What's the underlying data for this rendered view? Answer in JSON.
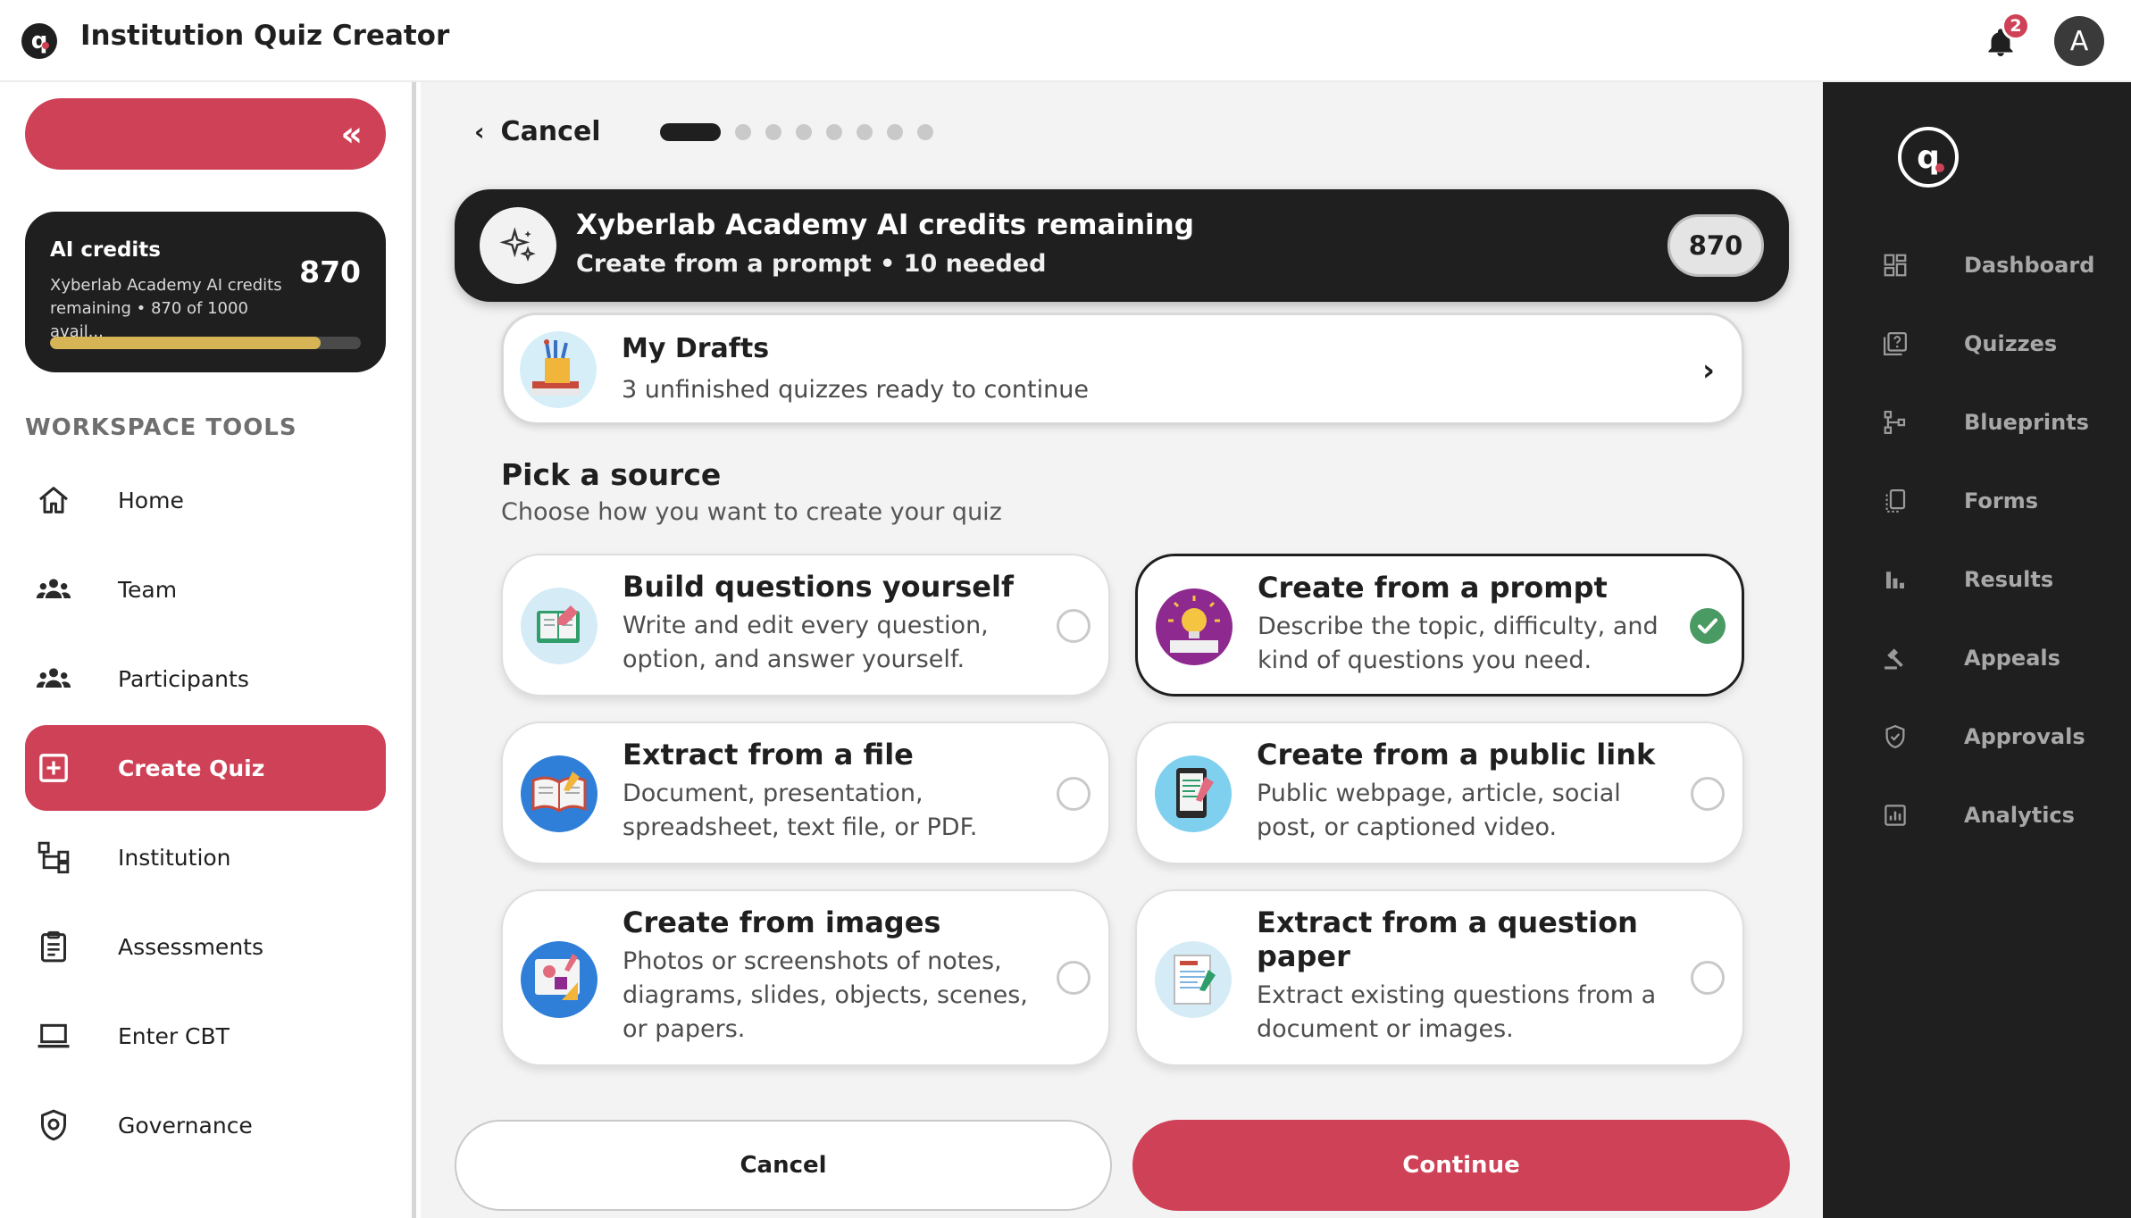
{
  "app": {
    "title": "Institution Quiz Creator",
    "logo_letter": "q",
    "notifications_count": "2",
    "avatar_initial": "A"
  },
  "sidebar": {
    "credits": {
      "title": "AI credits",
      "description": "Xyberlab Academy AI credits remaining • 870 of 1000 avail...",
      "value": "870",
      "progress": 0.87
    },
    "section_title": "WORKSPACE TOOLS",
    "items": [
      {
        "label": "Home",
        "icon": "home-icon"
      },
      {
        "label": "Team",
        "icon": "team-icon"
      },
      {
        "label": "Participants",
        "icon": "participants-icon"
      },
      {
        "label": "Create Quiz",
        "icon": "plus-square-icon",
        "active": true
      },
      {
        "label": "Institution",
        "icon": "org-chart-icon"
      },
      {
        "label": "Assessments",
        "icon": "clipboard-icon"
      },
      {
        "label": "Enter CBT",
        "icon": "laptop-icon"
      },
      {
        "label": "Governance",
        "icon": "shield-icon"
      }
    ]
  },
  "main": {
    "back_label": "Cancel",
    "steps": {
      "total": 8,
      "current": 1
    },
    "banner": {
      "title": "Xyberlab Academy AI credits remaining",
      "subtitle": "Create from a prompt • 10 needed",
      "value": "870"
    },
    "drafts": {
      "title": "My Drafts",
      "subtitle": "3 unfinished quizzes ready to continue"
    },
    "pick": {
      "title": "Pick a source",
      "subtitle": "Choose how you want to create your quiz"
    },
    "options": [
      {
        "title": "Build questions yourself",
        "description": "Write and edit every question, option, and answer yourself.",
        "selected": false
      },
      {
        "title": "Create from a prompt",
        "description": "Describe the topic, difficulty, and kind of questions you need.",
        "selected": true
      },
      {
        "title": "Extract from a file",
        "description": "Document, presentation, spreadsheet, text file, or PDF.",
        "selected": false
      },
      {
        "title": "Create from a public link",
        "description": "Public webpage, article, social post, or captioned video.",
        "selected": false
      },
      {
        "title": "Create from images",
        "description": "Photos or screenshots of notes, diagrams, slides, objects, scenes, or papers.",
        "selected": false
      },
      {
        "title": "Extract from a question paper",
        "description": "Extract existing questions from a document or images.",
        "selected": false
      }
    ],
    "buttons": {
      "cancel": "Cancel",
      "continue": "Continue"
    }
  },
  "rail": {
    "items": [
      {
        "label": "Dashboard",
        "icon": "dashboard-icon"
      },
      {
        "label": "Quizzes",
        "icon": "quiz-icon"
      },
      {
        "label": "Blueprints",
        "icon": "blueprint-icon"
      },
      {
        "label": "Forms",
        "icon": "forms-icon"
      },
      {
        "label": "Results",
        "icon": "results-icon"
      },
      {
        "label": "Appeals",
        "icon": "gavel-icon"
      },
      {
        "label": "Approvals",
        "icon": "shield-check-icon"
      },
      {
        "label": "Analytics",
        "icon": "analytics-icon"
      }
    ]
  },
  "colors": {
    "accent": "#cf4156",
    "dark": "#1f1f1f",
    "success": "#4a9a63",
    "credit_bar": "#d7b455"
  }
}
